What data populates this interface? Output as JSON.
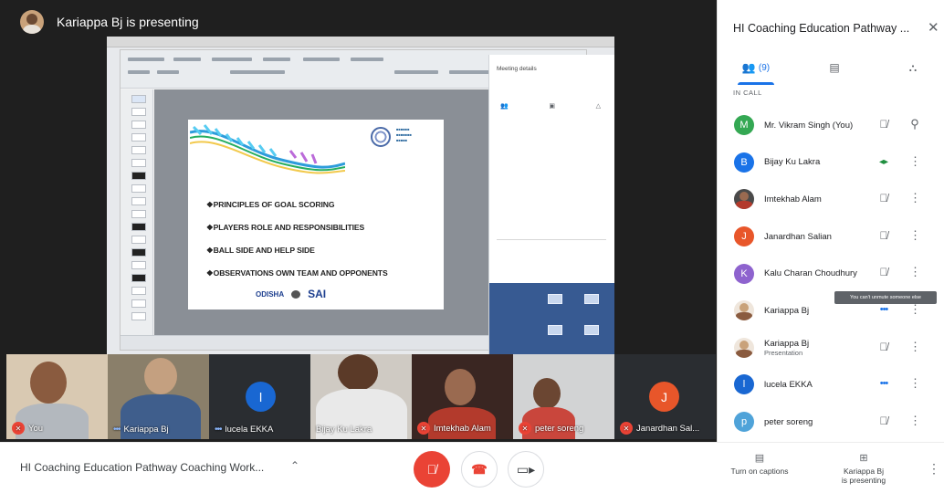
{
  "presenter": {
    "text": "Kariappa Bj is presenting"
  },
  "shared_screen": {
    "meeting_panel_title": "Meeting details",
    "slide_bullets": [
      "❖PRINCIPLES OF GOAL SCORING",
      "❖PLAYERS ROLE AND RESPONSIBILITIES",
      "❖BALL SIDE AND HELP SIDE",
      "❖OBSERVATIONS OWN TEAM AND OPPONENTS"
    ],
    "slide_logos": {
      "odisha": "ODISHA",
      "sai": "SAI"
    }
  },
  "filmstrip": [
    {
      "label": "You",
      "muted": true
    },
    {
      "label": "Kariappa Bj",
      "muted": false,
      "speaking_dots": "•••"
    },
    {
      "label": "lucela EKKA",
      "muted": false,
      "speaking_dots": "•••",
      "avatar_letter": "l",
      "avatar_color": "#1967d2"
    },
    {
      "label": "Bijay Ku Lakra",
      "muted": false
    },
    {
      "label": "Imtekhab Alam",
      "muted": true
    },
    {
      "label": "peter soreng",
      "muted": true
    },
    {
      "label": "Janardhan Sal...",
      "muted": true,
      "avatar_letter": "J",
      "avatar_color": "#e8562a"
    }
  ],
  "sidebar": {
    "title": "HI Coaching Education Pathway ...",
    "tabs": [
      {
        "label": "(9)",
        "icon": "people-icon",
        "active": true
      },
      {
        "label": "",
        "icon": "chat-icon",
        "active": false
      },
      {
        "label": "",
        "icon": "activities-icon",
        "active": false
      }
    ],
    "section_label": "IN CALL",
    "participants": [
      {
        "name": "Mr. Vikram Singh (You)",
        "sub": "",
        "avatar": "M",
        "color": "#34a853",
        "state": "muted",
        "action": "pin"
      },
      {
        "name": "Bijay Ku Lakra",
        "sub": "",
        "avatar": "B",
        "color": "#1a73e8",
        "state": "speaking",
        "action": "more"
      },
      {
        "name": "Imtekhab Alam",
        "sub": "",
        "avatar": "",
        "color": "#4a4a4a",
        "state": "muted",
        "action": "more"
      },
      {
        "name": "Janardhan Salian",
        "sub": "",
        "avatar": "J",
        "color": "#e8562a",
        "state": "muted",
        "action": "more"
      },
      {
        "name": "Kalu Charan Choudhury",
        "sub": "",
        "avatar": "K",
        "color": "#8e63ce",
        "state": "muted",
        "action": "more"
      },
      {
        "name": "Kariappa Bj",
        "sub": "",
        "avatar": "",
        "color": "#c9a27a",
        "state": "dots",
        "action": "more"
      },
      {
        "name": "Kariappa Bj",
        "sub": "Presentation",
        "avatar": "",
        "color": "#c9a27a",
        "state": "muted",
        "action": "more"
      },
      {
        "name": "lucela EKKA",
        "sub": "",
        "avatar": "l",
        "color": "#1967d2",
        "state": "dots",
        "action": "more"
      },
      {
        "name": "peter soreng",
        "sub": "",
        "avatar": "p",
        "color": "#4fa3d9",
        "state": "muted",
        "action": "more"
      }
    ],
    "tooltip": "You can't unmute someone else"
  },
  "bottom_bar": {
    "meeting_title": "HI Coaching Education Pathway Coaching Work...",
    "captions_label": "Turn on captions",
    "presenting_label": "Kariappa Bj\nis presenting"
  },
  "colors": {
    "red": "#ea4335",
    "blue": "#1a73e8",
    "green": "#1e8e3e"
  }
}
